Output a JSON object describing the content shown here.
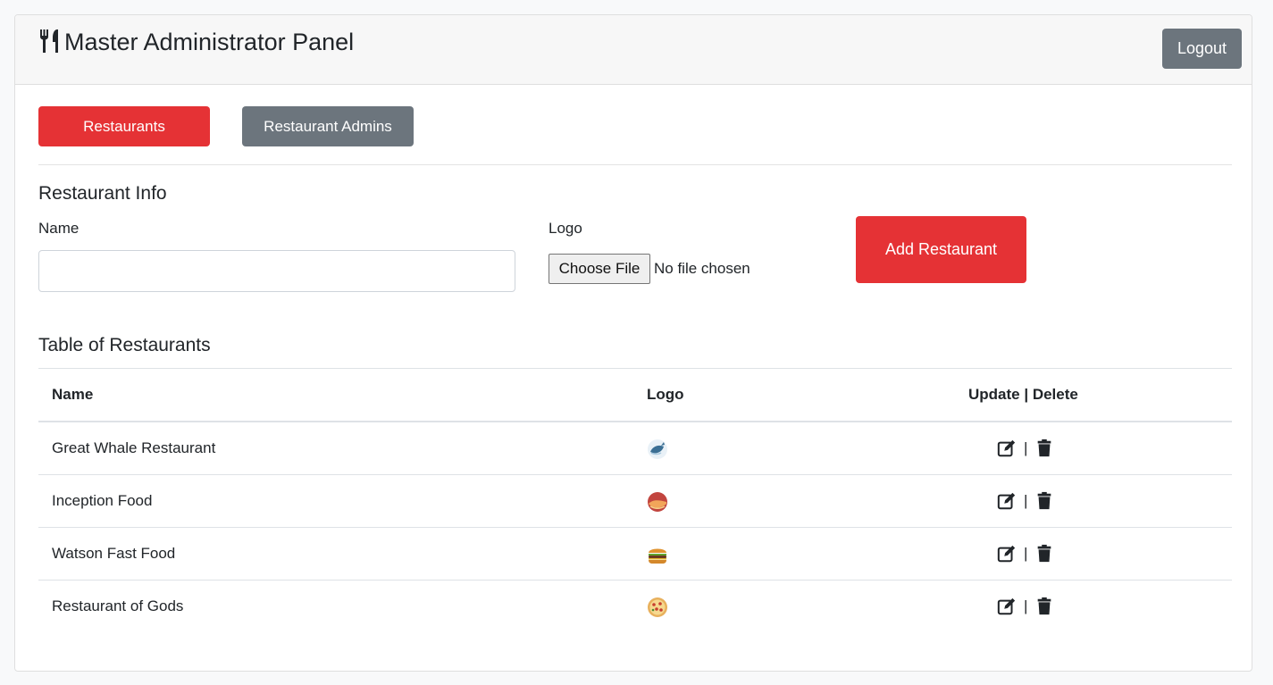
{
  "header": {
    "brand_icon": "utensils-icon",
    "title": "Master Administrator Panel",
    "logout_label": "Logout"
  },
  "tabs": {
    "restaurants_label": "Restaurants",
    "admins_label": "Restaurant Admins"
  },
  "form": {
    "section_title": "Restaurant Info",
    "name_label": "Name",
    "name_value": "",
    "logo_label": "Logo",
    "choose_file_label": "Choose File",
    "file_status": "No file chosen",
    "add_button_label": "Add Restaurant"
  },
  "table": {
    "title": "Table of Restaurants",
    "columns": [
      "Name",
      "Logo",
      "Update | Delete"
    ],
    "rows": [
      {
        "name": "Great Whale Restaurant",
        "logo_icon": "whale-logo-icon"
      },
      {
        "name": "Inception Food",
        "logo_icon": "sunset-logo-icon"
      },
      {
        "name": "Watson Fast Food",
        "logo_icon": "burger-logo-icon"
      },
      {
        "name": "Restaurant of Gods",
        "logo_icon": "pizza-logo-icon"
      }
    ],
    "action_separator": "|",
    "update_icon": "edit-icon",
    "delete_icon": "trash-icon"
  },
  "colors": {
    "primary_red": "#e53235",
    "secondary_gray": "#6c757d",
    "header_bg": "#f7f7f7",
    "page_bg": "#f8f9fa"
  }
}
